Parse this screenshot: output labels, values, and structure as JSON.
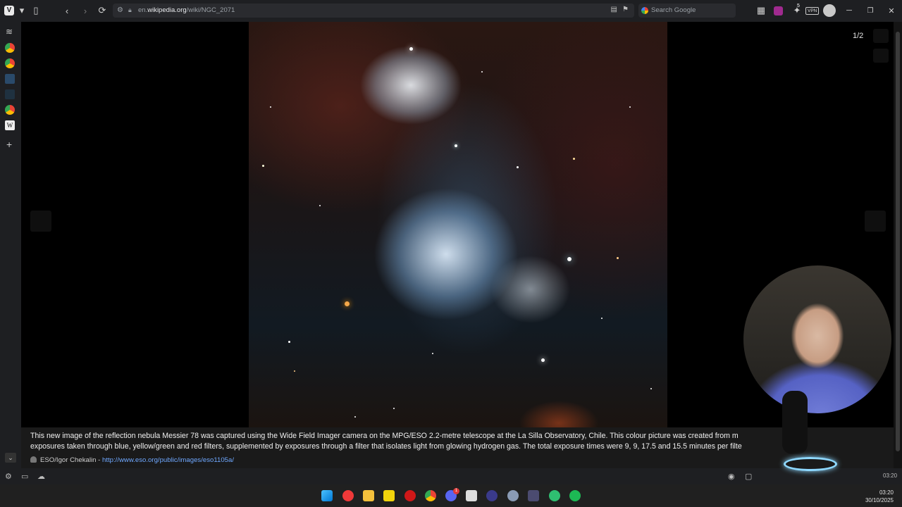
{
  "browser": {
    "url_prefix": "en.",
    "url_domain": "wikipedia.org",
    "url_path": "/wiki/NGC_2071",
    "search_placeholder": "Search Google",
    "vpn_label": "VPN",
    "extension_badge": "5"
  },
  "viewer": {
    "counter": "1/2",
    "caption_line1": "This new image of the reflection nebula Messier 78 was captured using the Wide Field Imager camera on the MPG/ESO 2.2-metre telescope at the La Silla Observatory, Chile. This colour picture was created from m",
    "caption_line2": "exposures taken through blue, yellow/green and red filters, supplemented by exposures through a filter that isolates light from glowing hydrogen gas. The total exposure times were 9, 9, 17.5 and 15.5 minutes per filte",
    "credit_author": "ESO/Igor Chekalin - ",
    "credit_link": "http://www.eso.org/public/images/eso1105a/"
  },
  "statusbar": {
    "time": "03:20"
  },
  "taskbar": {
    "time": "03:20",
    "date": "30/10/2025",
    "discord_badge": "1"
  },
  "colors": {
    "accent_link": "#6fa8ff",
    "chrome_bg": "#1e1f22"
  }
}
